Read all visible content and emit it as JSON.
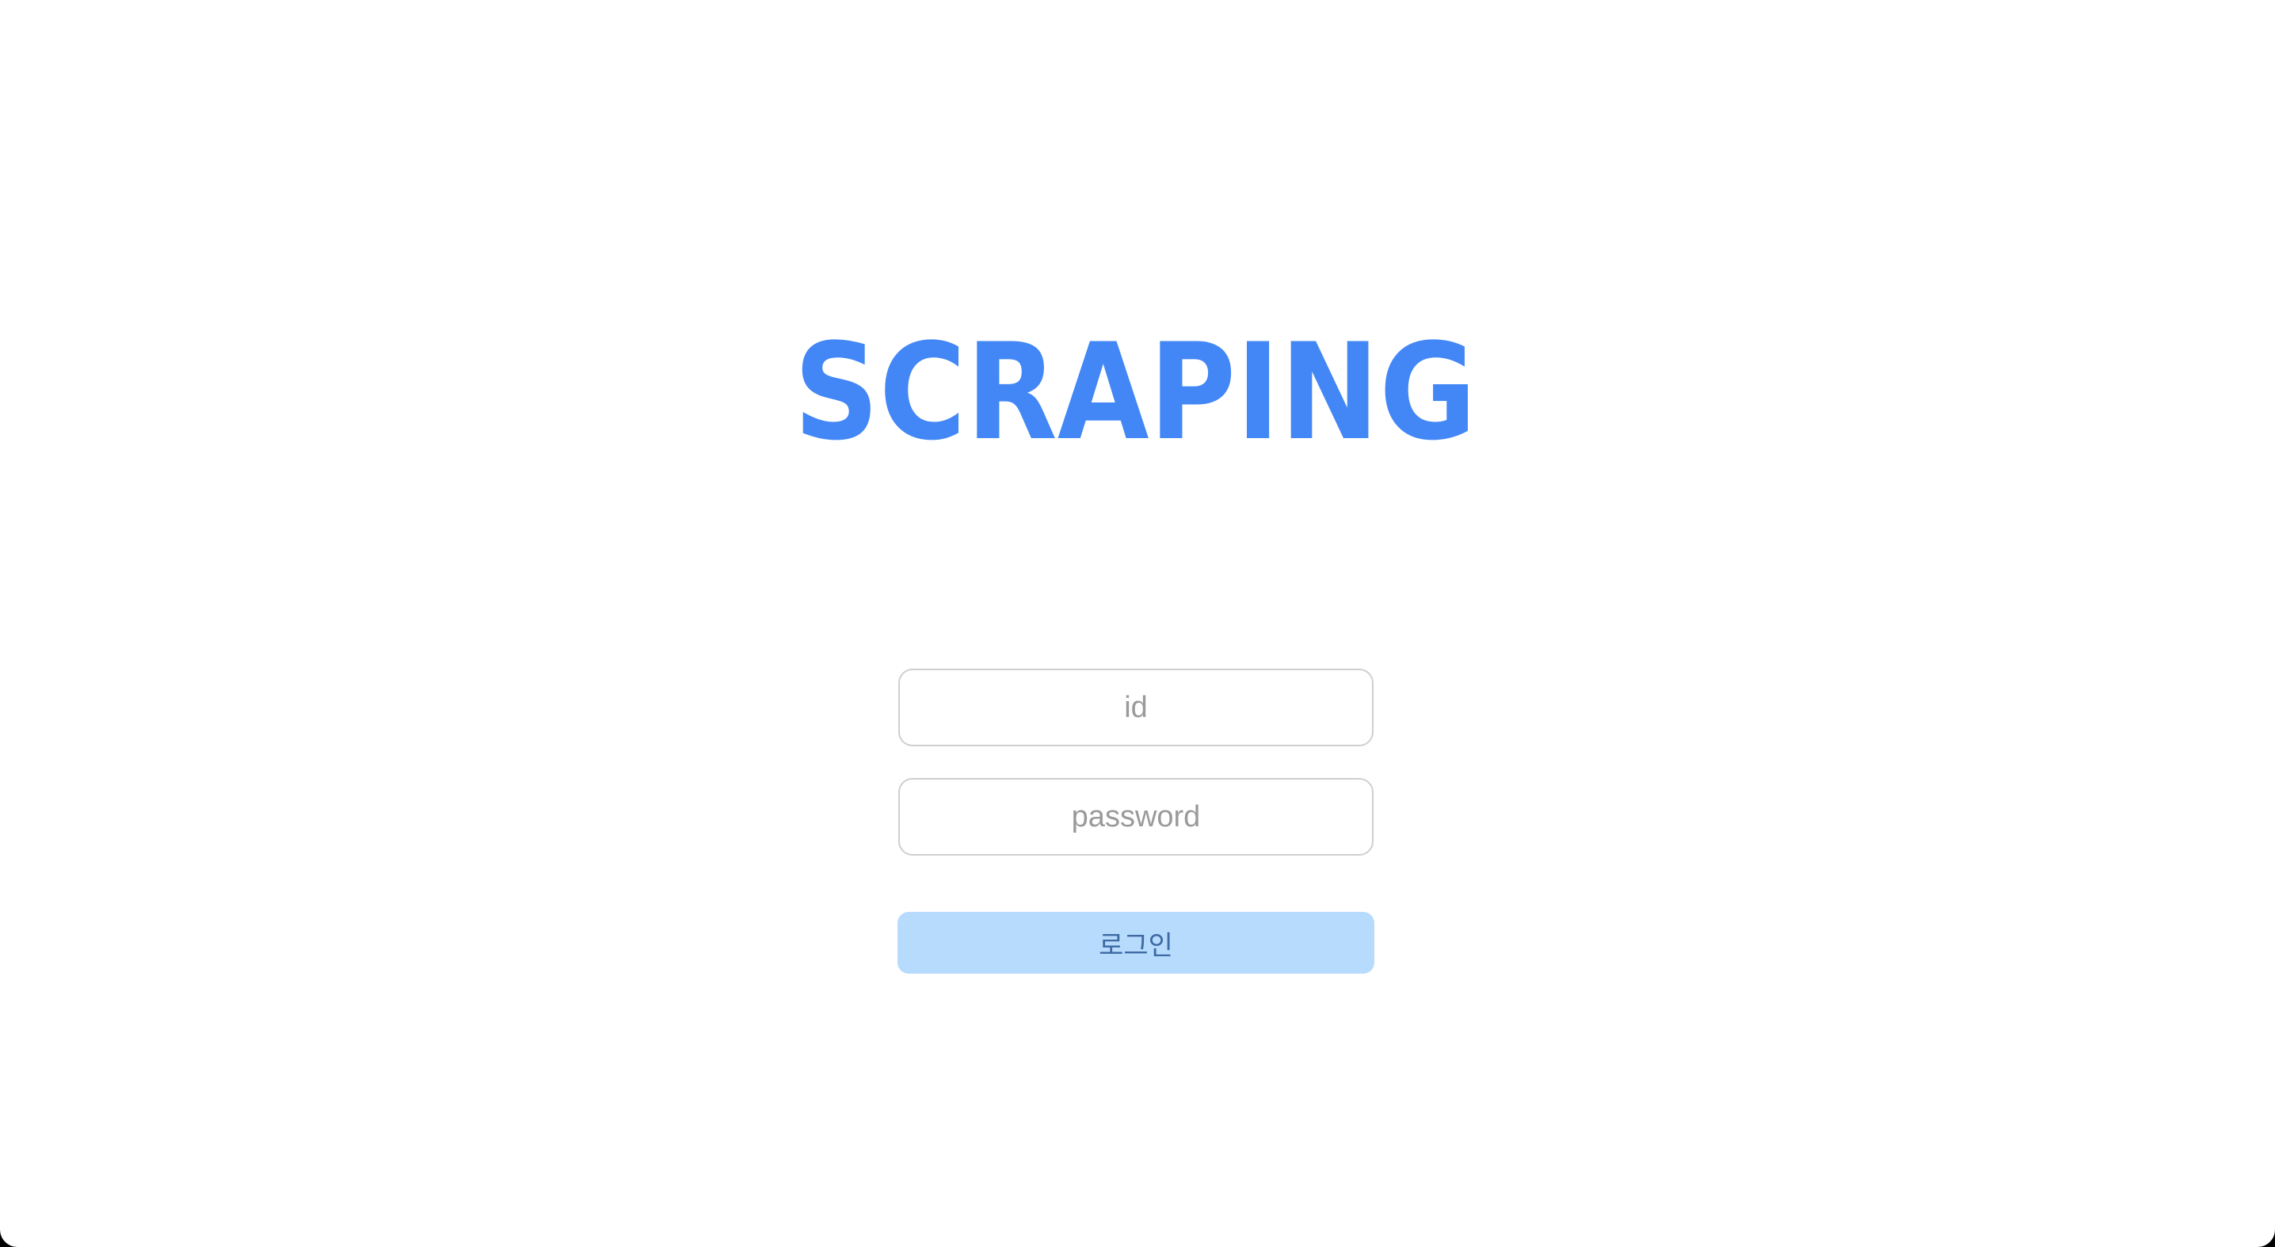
{
  "brand": {
    "logo_text": "SCRAPING",
    "color": "#4287f5"
  },
  "login_form": {
    "id_field": {
      "value": "",
      "placeholder": "id"
    },
    "password_field": {
      "value": "",
      "placeholder": "password"
    },
    "submit_label": "로그인",
    "submit_background": "#b7dbfd",
    "submit_text_color": "#3d6aa3"
  }
}
